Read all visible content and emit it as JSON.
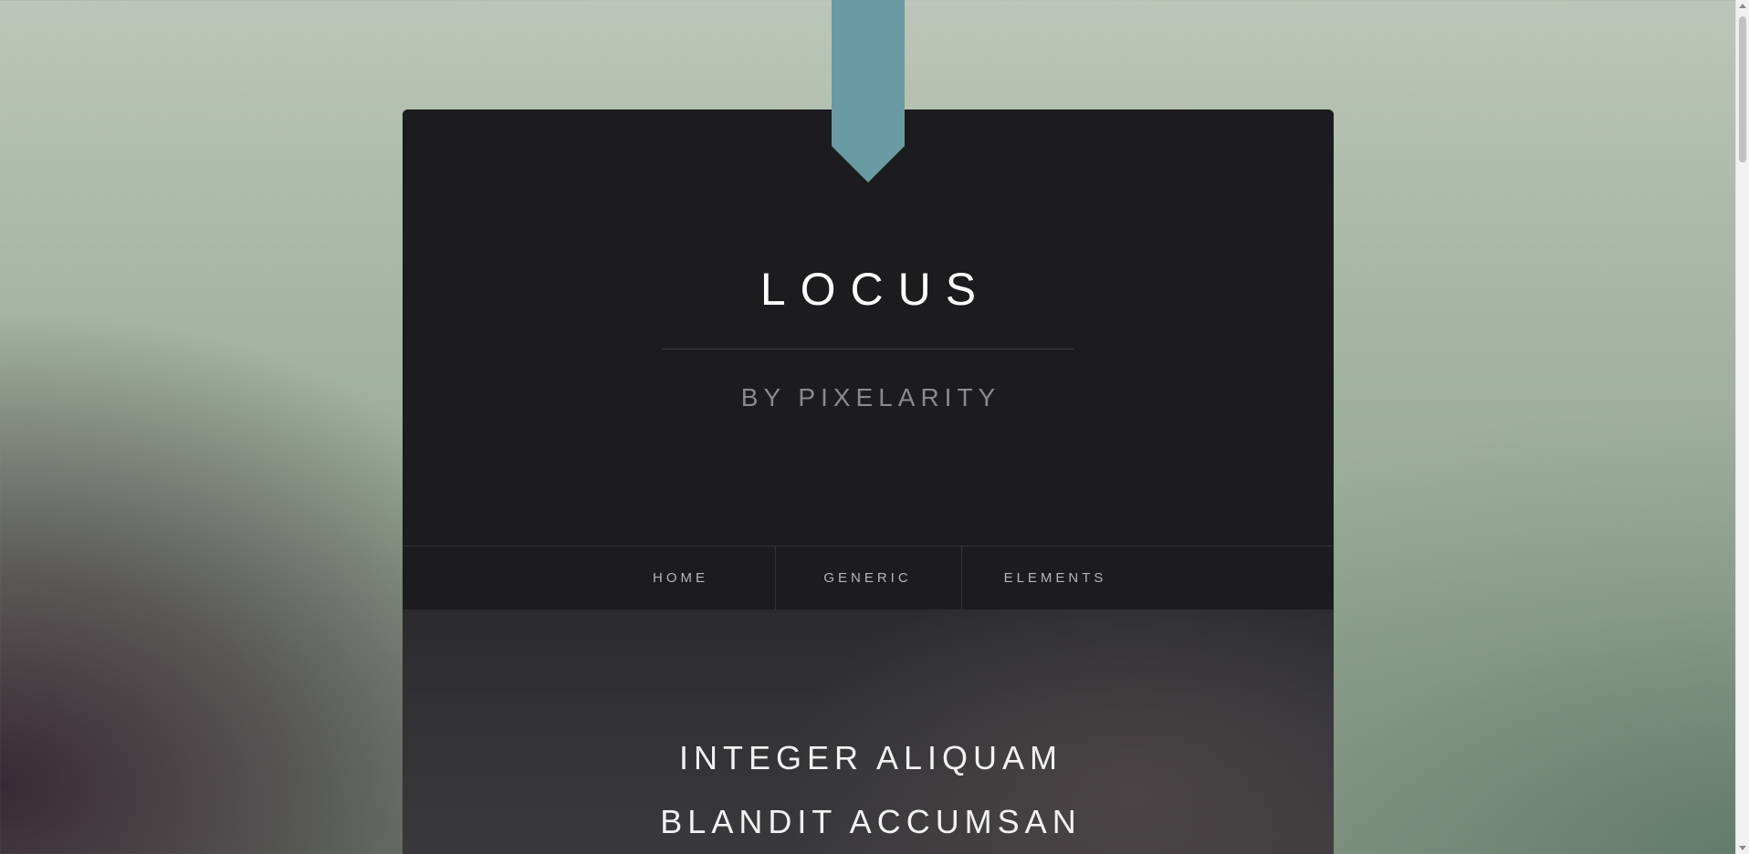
{
  "header": {
    "title": "LOCUS",
    "subtitle": "BY PIXELARITY"
  },
  "nav": {
    "items": [
      {
        "label": "HOME"
      },
      {
        "label": "GENERIC"
      },
      {
        "label": "ELEMENTS"
      }
    ]
  },
  "banner": {
    "heading_line1": "INTEGER ALIQUAM",
    "heading_line2": "BLANDIT ACCUMSAN"
  },
  "colors": {
    "ribbon": "#6a9ba2",
    "card": "#1c1c1e",
    "title": "#ffffff",
    "subtitle": "#8a8a8e"
  }
}
